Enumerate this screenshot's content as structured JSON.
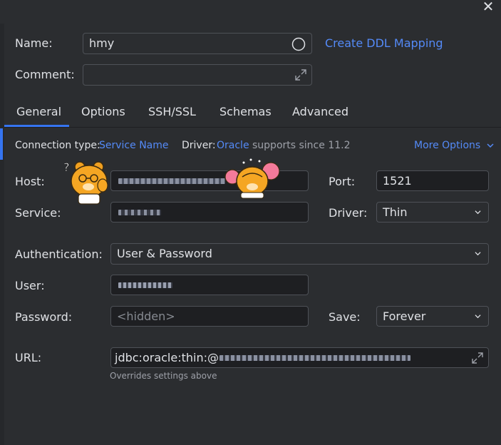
{
  "window": {
    "close_label": "✕"
  },
  "form": {
    "name_label": "Name:",
    "name_value": "hmy",
    "create_ddl_label": "Create DDL Mapping",
    "comment_label": "Comment:",
    "comment_value": ""
  },
  "tabs": [
    {
      "label": "General",
      "active": true
    },
    {
      "label": "Options"
    },
    {
      "label": "SSH/SSL"
    },
    {
      "label": "Schemas"
    },
    {
      "label": "Advanced"
    }
  ],
  "connection": {
    "type_label": "Connection type:",
    "type_value": "Service Name",
    "driver_label": "Driver:",
    "driver_value": "Oracle",
    "driver_note": "supports since 11.2",
    "more_options_label": "More Options"
  },
  "general": {
    "host_label": "Host:",
    "port_label": "Port:",
    "port_value": "1521",
    "service_label": "Service:",
    "driver_label": "Driver:",
    "driver_value": "Thin",
    "auth_label": "Authentication:",
    "auth_value": "User & Password",
    "user_label": "User:",
    "password_label": "Password:",
    "password_placeholder": "<hidden>",
    "save_label": "Save:",
    "save_value": "Forever",
    "url_label": "URL:",
    "url_prefix": "jdbc:oracle:thin:@",
    "url_note": "Overrides settings above"
  },
  "colors": {
    "accent": "#3574f0",
    "link": "#548af7",
    "background": "#2b2d30",
    "field_dark": "#1e1f22"
  }
}
